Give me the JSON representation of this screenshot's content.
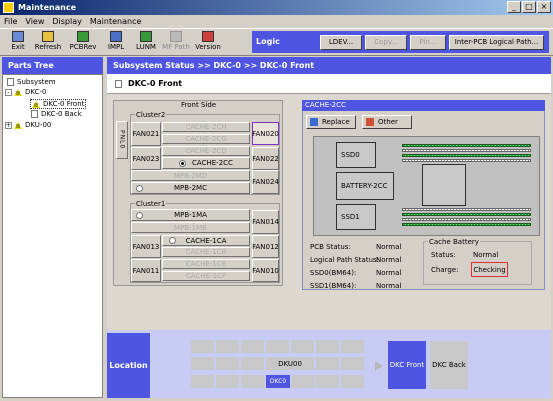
{
  "window": {
    "title": "Maintenance"
  },
  "menu": [
    "File",
    "View",
    "Display",
    "Maintenance"
  ],
  "toolbar": [
    {
      "label": "Exit",
      "icon": "exit-icon",
      "enabled": true
    },
    {
      "label": "Refresh",
      "icon": "refresh-icon",
      "enabled": true
    },
    {
      "label": "PCBRev",
      "icon": "pcbrev-icon",
      "enabled": true
    },
    {
      "label": "IMPL",
      "icon": "impl-icon",
      "enabled": true
    },
    {
      "label": "LUNM",
      "icon": "lunm-icon",
      "enabled": true
    },
    {
      "label": "MF Path",
      "icon": "mf-path-icon",
      "enabled": false
    },
    {
      "label": "Version",
      "icon": "version-icon",
      "enabled": true
    }
  ],
  "logic": {
    "label": "Logic Function",
    "buttons": [
      {
        "label": "LDEV...",
        "enabled": true
      },
      {
        "label": "Copy...",
        "enabled": false
      },
      {
        "label": "Pin...",
        "enabled": false
      },
      {
        "label": "Inter-PCB Logical Path...",
        "enabled": true
      }
    ]
  },
  "tree": {
    "header": "Parts Tree",
    "items": [
      "Subsystem",
      "DKC-0",
      "DKC-0 Front",
      "DKC-0 Back",
      "DKU-00"
    ]
  },
  "breadcrumb": "Subsystem Status >> DKC-0 >> DKC-0 Front",
  "page_title": "DKC-0 Front",
  "front": {
    "title": "Front Side",
    "pnl": "PNL0",
    "cluster2": "Cluster2",
    "cluster1": "Cluster1",
    "fans": {
      "fan021": "FAN021",
      "fan020": "FAN020",
      "fan023": "FAN023",
      "fan022": "FAN022",
      "fan024": "FAN024",
      "fan014": "FAN014",
      "fan013": "FAN013",
      "fan012": "FAN012",
      "fan011": "FAN011",
      "fan010": "FAN010"
    },
    "slots": {
      "cache2ch": "CACHE-2CH",
      "cache2cg": "CACHE-2CG",
      "cache2cd": "CACHE-2CD",
      "cache2cc": "CACHE-2CC",
      "mpb2md": "MPB-2MD",
      "mpb2mc": "MPB-2MC",
      "mpb1ma": "MPB-1MA",
      "mpb1mb": "MPB-1MB",
      "cache1ca": "CACHE-1CA",
      "cache1cb": "CACHE-1CB",
      "cache1ce": "CACHE-1CE",
      "cache1cf": "CACHE-1CF"
    }
  },
  "cache": {
    "title": "CACHE-2CC",
    "replace": "Replace",
    "other": "Other",
    "ssd0": "SSD0",
    "ssd1": "SSD1",
    "battery": "BATTERY-2CC",
    "status": [
      {
        "label": "PCB Status:",
        "value": "Normal"
      },
      {
        "label": "Logical Path Status:",
        "value": "Normal"
      },
      {
        "label": "SSD0(BM64):",
        "value": "Normal"
      },
      {
        "label": "SSD1(BM64):",
        "value": "Normal"
      }
    ],
    "cache_battery": {
      "title": "Cache Battery",
      "status_label": "Status:",
      "status_value": "Normal",
      "charge_label": "Charge:",
      "charge_value": "Checking"
    }
  },
  "location": {
    "label": "Location",
    "dku": "DKU00",
    "dkc": "DKC0",
    "front": "DKC Front",
    "back": "DKC Back"
  }
}
